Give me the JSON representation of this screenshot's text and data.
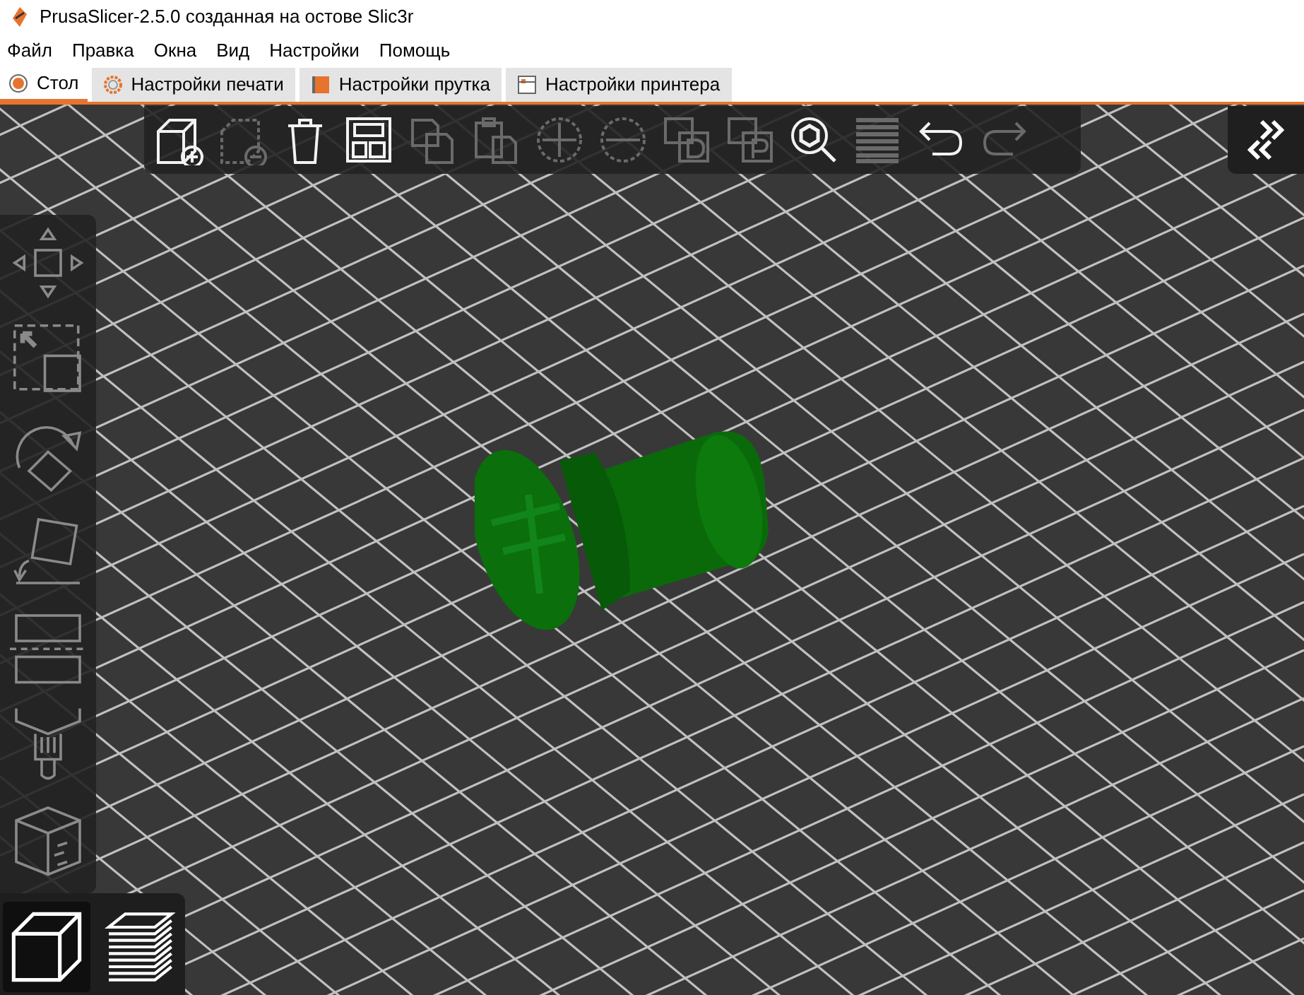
{
  "window": {
    "title": "PrusaSlicer-2.5.0 созданная на остове Slic3r"
  },
  "menu": [
    "Файл",
    "Правка",
    "Окна",
    "Вид",
    "Настройки",
    "Помощь"
  ],
  "tabs": [
    {
      "label": "Стол",
      "kind": "plater",
      "selected": true
    },
    {
      "label": "Настройки печати",
      "kind": "print",
      "selected": false
    },
    {
      "label": "Настройки прутка",
      "kind": "filament",
      "selected": false
    },
    {
      "label": "Настройки принтера",
      "kind": "printer",
      "selected": false
    }
  ],
  "top_toolbar": [
    {
      "kind": "add",
      "disabled": false
    },
    {
      "kind": "delete",
      "disabled": true
    },
    {
      "kind": "delete_all",
      "disabled": false
    },
    {
      "kind": "arrange",
      "disabled": false
    },
    {
      "kind": "copy",
      "disabled": true
    },
    {
      "kind": "paste",
      "disabled": true
    },
    {
      "kind": "add_instance",
      "disabled": true
    },
    {
      "kind": "remove_instance",
      "disabled": true
    },
    {
      "kind": "split_objects",
      "disabled": true
    },
    {
      "kind": "split_parts",
      "disabled": true
    },
    {
      "kind": "search",
      "disabled": false
    },
    {
      "kind": "layers",
      "disabled": true
    },
    {
      "kind": "undo",
      "disabled": false
    },
    {
      "kind": "redo",
      "disabled": true
    }
  ],
  "left_toolbar": [
    {
      "kind": "move"
    },
    {
      "kind": "scale"
    },
    {
      "kind": "rotate"
    },
    {
      "kind": "place_on_face"
    },
    {
      "kind": "cut"
    },
    {
      "kind": "paint"
    },
    {
      "kind": "seam"
    }
  ],
  "view_toolbar": [
    {
      "kind": "perspective",
      "selected": true
    },
    {
      "kind": "preview",
      "selected": false
    }
  ]
}
